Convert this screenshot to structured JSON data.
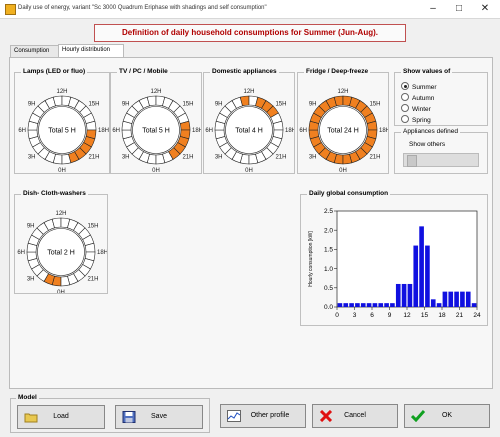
{
  "window": {
    "title": "Daily use of energy, variant \"Sc 3000 Quadrum Eriphase with shadings and self consumption\""
  },
  "header": {
    "banner": "Definition of daily household consumptions for Summer (Jun-Aug)."
  },
  "tabs": [
    {
      "label": "Consumption"
    },
    {
      "label": "Hourly distribution"
    }
  ],
  "clocks": [
    {
      "title": "Lamps (LED or fluo)",
      "total": "Total 5 H",
      "on_hours": [
        18,
        19,
        20,
        21,
        22
      ]
    },
    {
      "title": "TV / PC / Mobile",
      "total": "Total 5 H",
      "on_hours": [
        17,
        18,
        19,
        20,
        21
      ]
    },
    {
      "title": "Domestic appliances",
      "total": "Total 4 H",
      "on_hours": [
        11,
        13,
        14,
        15
      ]
    },
    {
      "title": "Fridge / Deep-freeze",
      "total": "Total 24 H",
      "on_hours": [
        0,
        1,
        2,
        3,
        4,
        5,
        6,
        7,
        8,
        9,
        10,
        11,
        12,
        13,
        14,
        15,
        16,
        17,
        18,
        19,
        20,
        21,
        22,
        23
      ]
    },
    {
      "title": "Dish- Cloth-washers",
      "total": "Total 2 H",
      "on_hours": [
        0,
        1
      ]
    }
  ],
  "clock_labels": {
    "top": "12H",
    "upper_left": "9H",
    "upper_right": "15H",
    "left": "6H",
    "right": "18H",
    "lower_left": "3H",
    "lower_right": "21H",
    "bottom": "0H"
  },
  "show_values": {
    "title": "Show values of",
    "options": [
      "Summer",
      "Autumn",
      "Winter",
      "Spring"
    ],
    "selected": "Summer"
  },
  "appliances_defined": {
    "title": "Appliances defined",
    "show_others": "Show others"
  },
  "daily_chart": {
    "title": "Daily global consumption"
  },
  "chart_data": {
    "type": "bar",
    "title": "Daily global consumption",
    "ylabel": "Hourly consumption [kW]",
    "xlabel": "",
    "x": [
      0,
      1,
      2,
      3,
      4,
      5,
      6,
      7,
      8,
      9,
      10,
      11,
      12,
      13,
      14,
      15,
      16,
      17,
      18,
      19,
      20,
      21,
      22,
      23
    ],
    "values": [
      0.1,
      0.1,
      0.1,
      0.1,
      0.1,
      0.1,
      0.1,
      0.1,
      0.1,
      0.1,
      0.6,
      0.6,
      0.6,
      1.6,
      2.1,
      1.6,
      0.2,
      0.1,
      0.4,
      0.4,
      0.4,
      0.4,
      0.4,
      0.1
    ],
    "xlim": [
      0,
      24
    ],
    "ylim": [
      0,
      2.5
    ],
    "xticks": [
      0,
      3,
      6,
      9,
      12,
      15,
      18,
      21,
      24
    ],
    "yticks": [
      0,
      0.5,
      1.0,
      1.5,
      2.0,
      2.5
    ],
    "ytick_labels": [
      "0.0",
      "0.5",
      "1.0",
      "1.5",
      "2.0",
      "2.5"
    ],
    "bar_color": "#1010e0",
    "grid": false
  },
  "model": {
    "title": "Model",
    "load": "Load",
    "save": "Save"
  },
  "buttons": {
    "other_profile": "Other profile",
    "cancel": "Cancel",
    "ok": "OK"
  },
  "colors": {
    "on_segment": "#f08020",
    "banner_text": "#b00000"
  }
}
